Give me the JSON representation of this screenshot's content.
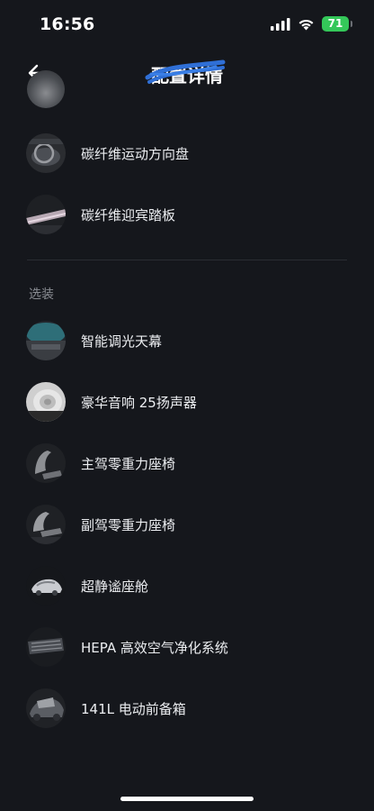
{
  "status_bar": {
    "time": "16:56",
    "battery": "71",
    "signal_icon": "signal-icon",
    "wifi_icon": "wifi-icon",
    "battery_icon": "battery-icon"
  },
  "header": {
    "title": "配置详情",
    "back_icon": "arrow-left-icon"
  },
  "standard_items": [
    {
      "label": "碳纤维运动方向盘",
      "icon": "steering-wheel-thumb"
    },
    {
      "label": "碳纤维迎宾踏板",
      "icon": "sill-plate-thumb"
    }
  ],
  "optional_section": {
    "title": "选装",
    "items": [
      {
        "label": "智能调光天幕",
        "icon": "sunroof-thumb"
      },
      {
        "label": "豪华音响 25扬声器",
        "icon": "speaker-thumb"
      },
      {
        "label": "主驾零重力座椅",
        "icon": "driver-seat-thumb"
      },
      {
        "label": "副驾零重力座椅",
        "icon": "passenger-seat-thumb"
      },
      {
        "label": "超静谧座舱",
        "icon": "quiet-cabin-thumb"
      },
      {
        "label": "HEPA 高效空气净化系统",
        "icon": "air-filter-thumb"
      },
      {
        "label": "141L 电动前备箱",
        "icon": "frunk-thumb"
      }
    ]
  },
  "colors": {
    "background": "#15171c",
    "text": "#eceef1",
    "muted": "#8a8d93",
    "battery_green": "#34c759",
    "scribble_blue": "#2f6fd6"
  }
}
